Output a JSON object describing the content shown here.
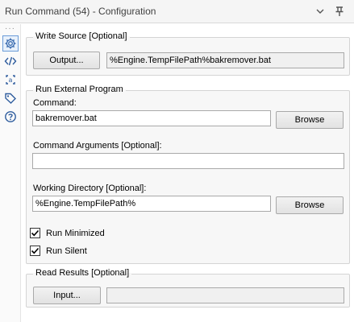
{
  "window": {
    "title": "Run Command (54) - Configuration"
  },
  "sidebar": {
    "items": [
      {
        "icon": "gear-icon"
      },
      {
        "icon": "code-icon"
      },
      {
        "icon": "annotation-icon"
      },
      {
        "icon": "tag-icon"
      },
      {
        "icon": "help-icon"
      }
    ]
  },
  "write_source": {
    "title": "Write Source [Optional]",
    "output_button": "Output...",
    "output_value": "%Engine.TempFilePath%bakremover.bat"
  },
  "run_external": {
    "title": "Run External Program",
    "command_label": "Command:",
    "command_value": "bakremover.bat",
    "browse_label": "Browse",
    "args_label": "Command Arguments [Optional]:",
    "args_value": "",
    "workdir_label": "Working Directory [Optional]:",
    "workdir_value": "%Engine.TempFilePath%",
    "workdir_browse_label": "Browse"
  },
  "options": {
    "run_minimized_label": "Run Minimized",
    "run_minimized_checked": true,
    "run_silent_label": "Run Silent",
    "run_silent_checked": true
  },
  "read_results": {
    "title": "Read Results [Optional]",
    "input_button": "Input...",
    "input_value": ""
  }
}
